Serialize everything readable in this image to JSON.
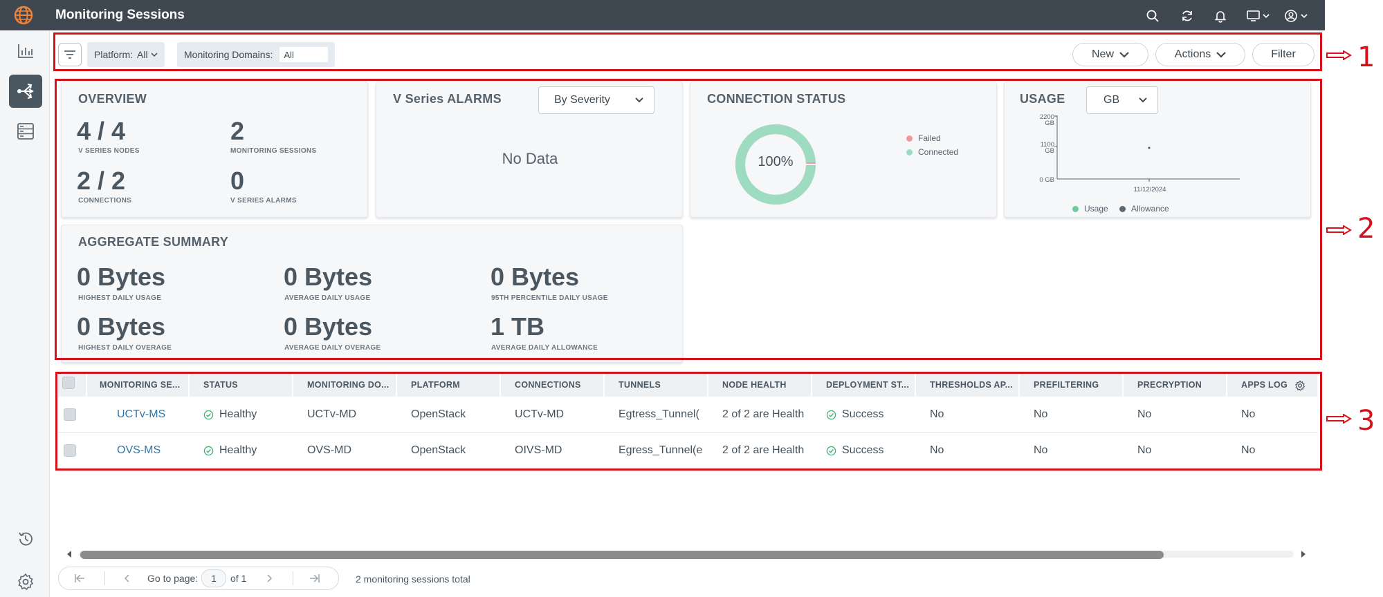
{
  "app": {
    "title": "Monitoring Sessions"
  },
  "toolbar": {
    "platform_label": "Platform:",
    "platform_value": "All",
    "domains_label": "Monitoring Domains:",
    "domains_value": "All",
    "new_label": "New",
    "actions_label": "Actions",
    "filter_label": "Filter"
  },
  "overview": {
    "title": "OVERVIEW",
    "nodes_value": "4 / 4",
    "nodes_label": "V SERIES NODES",
    "sessions_value": "2",
    "sessions_label": "MONITORING SESSIONS",
    "connections_value": "2 / 2",
    "connections_label": "CONNECTIONS",
    "alarms_value": "0",
    "alarms_label": "V SERIES ALARMS"
  },
  "alarms": {
    "title": "V Series ALARMS",
    "dropdown": "By Severity",
    "empty": "No Data"
  },
  "connection_status": {
    "title": "CONNECTION STATUS",
    "percent": "100%",
    "legend_failed": "Failed",
    "legend_connected": "Connected",
    "connected_fraction": 0.99,
    "colors": {
      "failed": "#ef9a9a",
      "connected": "#9ddcc0"
    }
  },
  "usage": {
    "title": "USAGE",
    "dropdown": "GB",
    "y_top": "2200",
    "y_mid": "1100",
    "y_unit": "GB",
    "y_zero": "0 GB",
    "x_tick": "11/12/2024",
    "legend_usage": "Usage",
    "legend_allowance": "Allowance"
  },
  "aggregate": {
    "title": "AGGREGATE SUMMARY",
    "items": [
      {
        "value": "0 Bytes",
        "label": "HIGHEST DAILY USAGE"
      },
      {
        "value": "0 Bytes",
        "label": "AVERAGE DAILY USAGE"
      },
      {
        "value": "0 Bytes",
        "label": "95TH PERCENTILE DAILY USAGE"
      },
      {
        "value": "0 Bytes",
        "label": "HIGHEST DAILY OVERAGE"
      },
      {
        "value": "0 Bytes",
        "label": "AVERAGE DAILY OVERAGE"
      },
      {
        "value": "1 TB",
        "label": "AVERAGE DAILY ALLOWANCE"
      }
    ]
  },
  "table": {
    "headers": [
      "MONITORING SE...",
      "STATUS",
      "MONITORING DO...",
      "PLATFORM",
      "CONNECTIONS",
      "TUNNELS",
      "NODE HEALTH",
      "DEPLOYMENT ST...",
      "THRESHOLDS AP...",
      "PREFILTERING",
      "PRECRYPTION",
      "APPS LOG"
    ],
    "rows": [
      [
        "UCTv-MS",
        "Healthy",
        "UCTv-MD",
        "OpenStack",
        "UCTv-MD",
        "Egtress_Tunnel(",
        "2 of 2 are Health",
        "Success",
        "No",
        "No",
        "No",
        "No"
      ],
      [
        "OVS-MS",
        "Healthy",
        "OVS-MD",
        "OpenStack",
        "OIVS-MD",
        "Egress_Tunnel(e",
        "2 of 2 are Health",
        "Success",
        "No",
        "No",
        "No",
        "No"
      ]
    ]
  },
  "pager": {
    "goto_label": "Go to page:",
    "page": "1",
    "of_label": "of 1",
    "total": "2 monitoring sessions total"
  },
  "annotations": {
    "m1": "1",
    "m2": "2",
    "m3": "3"
  },
  "colors": {
    "topbar": "#3f4851",
    "annotation": "#d5121b",
    "link": "#2c77ad",
    "success": "#3bb273"
  }
}
